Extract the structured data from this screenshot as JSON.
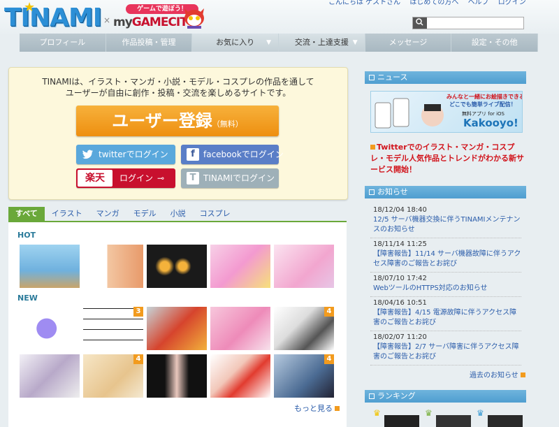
{
  "header": {
    "logo": "TINAMI",
    "cross": "×",
    "partner_tag": "ゲームで遊ぼう！",
    "partner_logo_my": "my",
    "partner_logo_rest": "GAMECITY",
    "top_links": [
      "こんにちは ゲストさん",
      "はじめての方へ",
      "ヘルプ",
      "ログイン"
    ],
    "search_placeholder": "",
    "search_icon": "search-icon"
  },
  "nav": {
    "items": [
      "プロフィール",
      "作品投稿・管理",
      "お気に入り",
      "交流・上達支援",
      "メッセージ",
      "設定・その他"
    ]
  },
  "hero": {
    "desc_line1": "TINAMIは、イラスト・マンガ・小説・モデル・コスプレの作品を通して",
    "desc_line2": "ユーザーが自由に創作・投稿・交流を楽しめるサイトです。",
    "register": "ユーザー登録",
    "register_free": "（無料）",
    "twitter_login": "twitterでログイン",
    "facebook_login": "facebookでログイン",
    "rakuten_logo": "楽天",
    "rakuten_login": "ログイン",
    "tinami_login": "TINAMIでログイン"
  },
  "tabs": [
    "すべて",
    "イラスト",
    "マンガ",
    "モデル",
    "小説",
    "コスプレ"
  ],
  "gallery": {
    "hot_label": "HOT",
    "new_label": "NEW",
    "badges": {
      "new1": "3",
      "new4": "4",
      "new9": "4"
    },
    "more": "もっと見る"
  },
  "sidebar": {
    "news_title": "ニュース",
    "banner_line1": "みんなと一緒にお絵描きできる！",
    "banner_line2": "どこでも簡単ライブ配信！",
    "banner_app": "無料アプリ for iOS",
    "banner_name": "Kakooyo!",
    "news_text": "Twitterでのイラスト・マンガ・コスプレ・モデル人気作品とトレンドがわかる新サービス開始！",
    "notices_title": "お知らせ",
    "notices": [
      {
        "date": "18/12/04 18:40",
        "text": "12/5 サーバ機器交換に伴うTINAMIメンテナンスのお知らせ"
      },
      {
        "date": "18/11/14 11:25",
        "text": "【障害報告】11/14 サーバ機器故障に伴うアクセス障害のご報告とお詫び"
      },
      {
        "date": "18/07/10 17:42",
        "text": "WebツールのHTTPS対応のお知らせ"
      },
      {
        "date": "18/04/16 10:51",
        "text": "【障害報告】4/15 電源故障に伴うアクセス障害のご報告とお詫び"
      },
      {
        "date": "18/02/07 11:20",
        "text": "【障害報告】2/7 サーバ障害に伴うアクセス障害のご報告とお詫び"
      }
    ],
    "past_notices": "過去のお知らせ",
    "ranking_title": "ランキング"
  }
}
